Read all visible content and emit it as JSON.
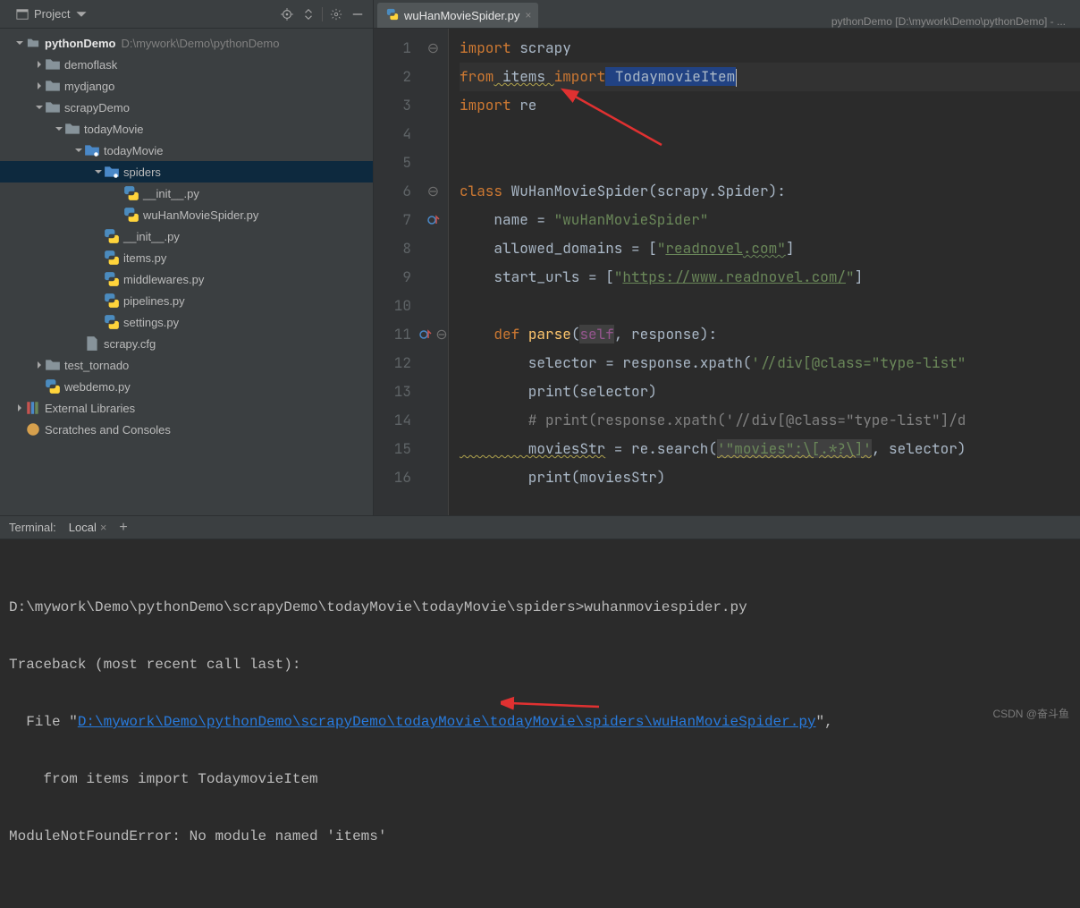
{
  "window_title": "pythonDemo [D:\\mywork\\Demo\\pythonDemo] - ...",
  "sidebar": {
    "title": "Project",
    "tree": {
      "root": {
        "label": "pythonDemo",
        "path": "D:\\mywork\\Demo\\pythonDemo"
      },
      "items": [
        {
          "depth": 1,
          "type": "folder",
          "expandable": true,
          "label": "demoflask"
        },
        {
          "depth": 1,
          "type": "folder",
          "expandable": true,
          "label": "mydjango"
        },
        {
          "depth": 1,
          "type": "folder",
          "expandable": true,
          "expanded": true,
          "label": "scrapyDemo"
        },
        {
          "depth": 2,
          "type": "folder",
          "expandable": true,
          "expanded": true,
          "label": "todayMovie"
        },
        {
          "depth": 3,
          "type": "pkg",
          "expandable": true,
          "expanded": true,
          "label": "todayMovie"
        },
        {
          "depth": 4,
          "type": "pkg",
          "expandable": true,
          "expanded": true,
          "label": "spiders",
          "selected": true
        },
        {
          "depth": 5,
          "type": "py",
          "label": "__init__.py"
        },
        {
          "depth": 5,
          "type": "py",
          "label": "wuHanMovieSpider.py"
        },
        {
          "depth": 4,
          "type": "py",
          "label": "__init__.py"
        },
        {
          "depth": 4,
          "type": "py",
          "label": "items.py"
        },
        {
          "depth": 4,
          "type": "py",
          "label": "middlewares.py"
        },
        {
          "depth": 4,
          "type": "py",
          "label": "pipelines.py"
        },
        {
          "depth": 4,
          "type": "py",
          "label": "settings.py"
        },
        {
          "depth": 3,
          "type": "file",
          "label": "scrapy.cfg"
        },
        {
          "depth": 1,
          "type": "folder",
          "expandable": true,
          "label": "test_tornado"
        },
        {
          "depth": 1,
          "type": "py",
          "label": "webdemo.py"
        }
      ],
      "libraries": "External Libraries",
      "scratches": "Scratches and Consoles"
    }
  },
  "editor": {
    "tab_label": "wuHanMovieSpider.py",
    "code": {
      "l1_a": "import",
      "l1_b": " scrapy",
      "l2_a": "from",
      "l2_b": " items ",
      "l2_c": "import",
      "l2_d": " TodaymovieItem",
      "l3_a": "import",
      "l3_b": " re",
      "l6_a": "class ",
      "l6_b": "WuHanMovieSpider",
      "l6_c": "(scrapy.Spider):",
      "l7_a": "    name = ",
      "l7_b": "\"wuHanMovieSpider\"",
      "l8_a": "    allowed_domains = [",
      "l8_b": "\"",
      "l8_c": "readnovel",
      "l8_d": ".com\"",
      "l8_e": "]",
      "l9_a": "    start_urls = [",
      "l9_b": "\"",
      "l9_c": "https://www.readnovel.com/",
      "l9_d": "\"",
      "l9_e": "]",
      "l11_a": "    ",
      "l11_b": "def ",
      "l11_c": "parse",
      "l11_d": "(",
      "l11_e": "self",
      "l11_f": ", response",
      "l11_g": "):",
      "l12_a": "        selector = response.xpath(",
      "l12_b": "'//div[@class=\"type-list\"",
      "l13_a": "        print(selector)",
      "l14_a": "        # print(response.xpath('//div[@class=\"type-list\"]/d",
      "l15_a": "        moviesStr",
      "l15_b": " = re.search(",
      "l15_c": "'\"movies\":\\[.*?\\]'",
      "l15_d": ", selector)",
      "l16_a": "        print(moviesStr)"
    }
  },
  "terminal": {
    "title": "Terminal:",
    "tab": "Local",
    "lines": {
      "l1": "D:\\mywork\\Demo\\pythonDemo\\scrapyDemo\\todayMovie\\todayMovie\\spiders>wuhanmoviespider.py",
      "l2": "Traceback (most recent call last):",
      "l3_a": "  File \"",
      "l3_b": "D:\\mywork\\Demo\\pythonDemo\\scrapyDemo\\todayMovie\\todayMovie\\spiders\\wuHanMovieSpider.py",
      "l3_c": "\",",
      "l4": "    from items import TodaymovieItem",
      "l5": "ModuleNotFoundError: No module named 'items'"
    }
  },
  "watermark": "CSDN @奋斗鱼"
}
